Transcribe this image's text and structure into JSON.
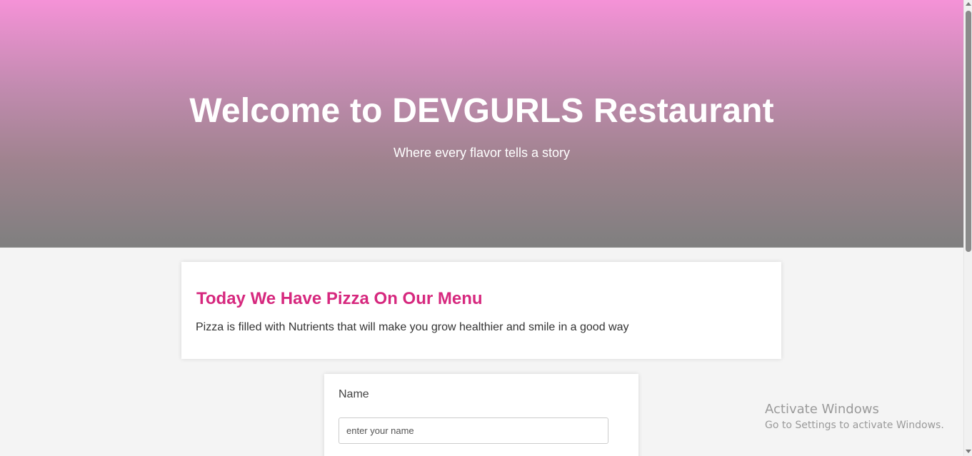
{
  "hero": {
    "title": "Welcome to DEVGURLS Restaurant",
    "subtitle": "Where every flavor tells a story",
    "gradient_top": "#f592d7",
    "gradient_bottom": "#7f7f7f"
  },
  "menu": {
    "heading": "Today We Have Pizza On Our Menu",
    "text": "Pizza is filled with Nutrients that will make you grow healthier and smile in a good way",
    "heading_color": "#d6287e"
  },
  "form": {
    "name_label": "Name",
    "name_value": "",
    "name_placeholder": "enter your name"
  },
  "os_watermark": {
    "title": "Activate Windows",
    "subtitle": "Go to Settings to activate Windows."
  },
  "icons": {
    "scroll_up": "chevron-up-icon",
    "scroll_down": "chevron-down-icon"
  }
}
